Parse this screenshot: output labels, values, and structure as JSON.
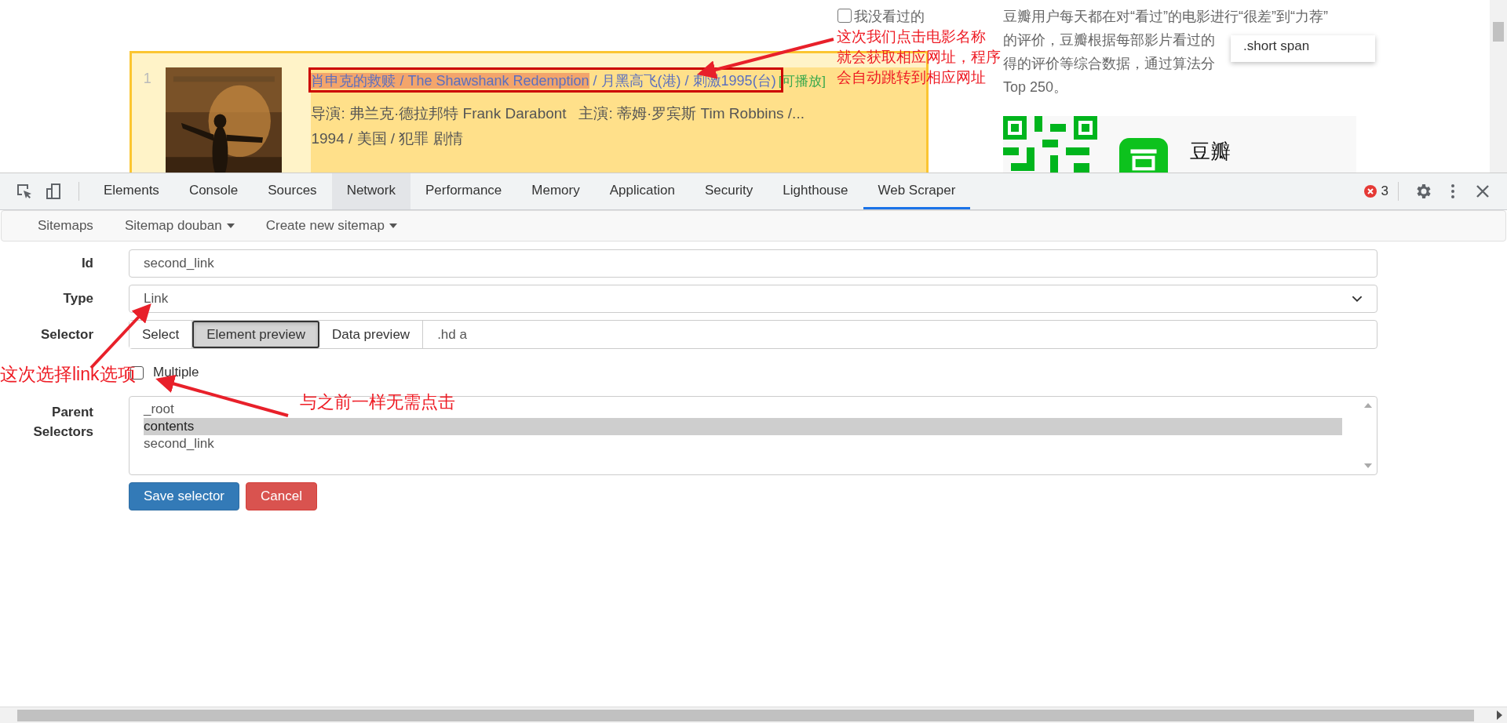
{
  "page": {
    "filter_checkbox": {
      "label": "我没看过的",
      "checked": false
    },
    "movie": {
      "rank": "1",
      "title_parts": [
        {
          "text": "肖申克的救赎",
          "kind": "highlight"
        },
        {
          "text": " / The Shawshank Redemption",
          "kind": "highlight"
        },
        {
          "text": " / 月黑高飞(港) / 刺激1995(台)",
          "kind": "plain"
        }
      ],
      "playable": "[可播放]",
      "credits": "导演: 弗兰克·德拉邦特 Frank Darabont   主演: 蒂姆·罗宾斯 Tim Robbins /...",
      "info": "1994 / 美国 / 犯罪 剧情"
    },
    "sidebar_lines": [
      "豆瓣用户每天都在对“看过”的电影进行“很差”到“力荐”",
      "的评价，豆瓣根据每部影片看过的",
      "得的评价等综合数据，通过算法分",
      "Top 250。"
    ],
    "app_name": "豆瓣",
    "tooltip": ".short span"
  },
  "devtools": {
    "tabs": [
      {
        "label": "Elements",
        "selected": false,
        "hovered": false
      },
      {
        "label": "Console",
        "selected": false,
        "hovered": false
      },
      {
        "label": "Sources",
        "selected": false,
        "hovered": false
      },
      {
        "label": "Network",
        "selected": false,
        "hovered": true
      },
      {
        "label": "Performance",
        "selected": false,
        "hovered": false
      },
      {
        "label": "Memory",
        "selected": false,
        "hovered": false
      },
      {
        "label": "Application",
        "selected": false,
        "hovered": false
      },
      {
        "label": "Security",
        "selected": false,
        "hovered": false
      },
      {
        "label": "Lighthouse",
        "selected": false,
        "hovered": false
      },
      {
        "label": "Web Scraper",
        "selected": true,
        "hovered": false
      }
    ],
    "error_count": "3"
  },
  "scraper_nav": [
    {
      "label": "Sitemaps",
      "dropdown": false
    },
    {
      "label": "Sitemap douban",
      "dropdown": true
    },
    {
      "label": "Create new sitemap",
      "dropdown": true
    }
  ],
  "form": {
    "id_label": "Id",
    "id_value": "second_link",
    "type_label": "Type",
    "type_value": "Link",
    "selector_label": "Selector",
    "selector_buttons": [
      {
        "label": "Select",
        "selected": false
      },
      {
        "label": "Element preview",
        "selected": true
      },
      {
        "label": "Data preview",
        "selected": false
      }
    ],
    "selector_value": ".hd a",
    "multiple": {
      "label": "Multiple",
      "checked": false
    },
    "parent_label": "Parent Selectors",
    "parent_selectors": [
      {
        "label": "_root",
        "selected": false
      },
      {
        "label": "contents",
        "selected": true
      },
      {
        "label": "second_link",
        "selected": false
      }
    ],
    "buttons": [
      {
        "label": "Save selector",
        "kind": "primary"
      },
      {
        "label": "Cancel",
        "kind": "danger"
      }
    ]
  },
  "annotations": [
    {
      "lines": [
        "这次我们点击电影名称",
        "就会获取相应网址，程序",
        "会自动跳转到相应网址"
      ],
      "kind": "top"
    },
    {
      "lines": [
        "这次选择link选项"
      ],
      "kind": "type"
    },
    {
      "lines": [
        "与之前一样无需点击"
      ],
      "kind": "parent"
    }
  ]
}
